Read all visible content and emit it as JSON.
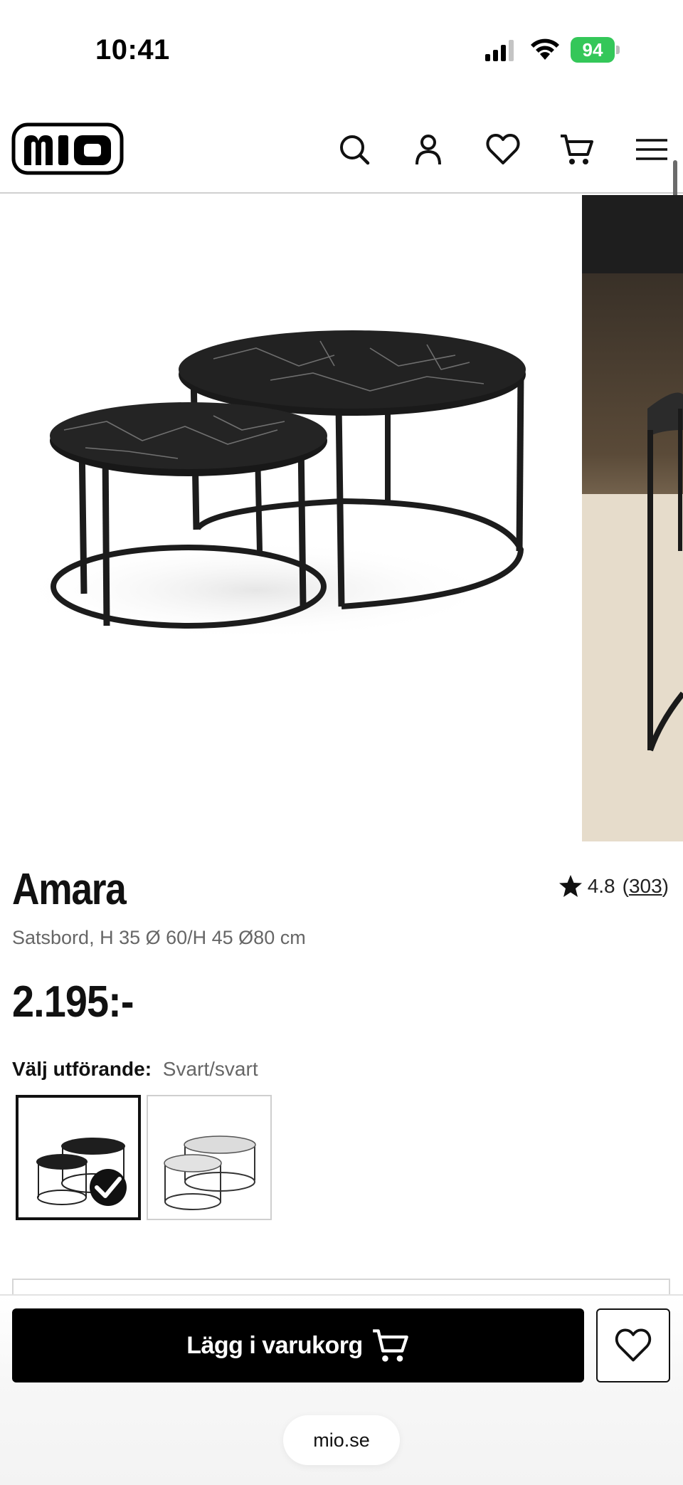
{
  "status_bar": {
    "time": "10:41",
    "battery_percent": "94"
  },
  "header": {
    "logo_text": "mio",
    "icons": [
      "search-icon",
      "account-icon",
      "heart-icon",
      "cart-icon",
      "menu-icon"
    ]
  },
  "gallery": {
    "images": [
      "product-image-marble-black",
      "product-image-lifestyle"
    ]
  },
  "product": {
    "name": "Amara",
    "subtitle": "Satsbord, H 35 Ø 60/H 45 Ø80 cm",
    "price": "2.195:-",
    "rating": {
      "value": "4.8",
      "count": "303",
      "open_paren": "(",
      "close_paren": ")"
    },
    "variant": {
      "label": "Välj utförande:",
      "selected": "Svart/svart",
      "options": [
        "Svart/svart",
        "white-marble-variant"
      ]
    }
  },
  "actions": {
    "add_to_cart_label": "Lägg i varukorg"
  },
  "browser": {
    "url": "mio.se"
  },
  "colors": {
    "brand_black": "#000000",
    "battery_green": "#34c759",
    "divider": "#d0d0d0"
  }
}
